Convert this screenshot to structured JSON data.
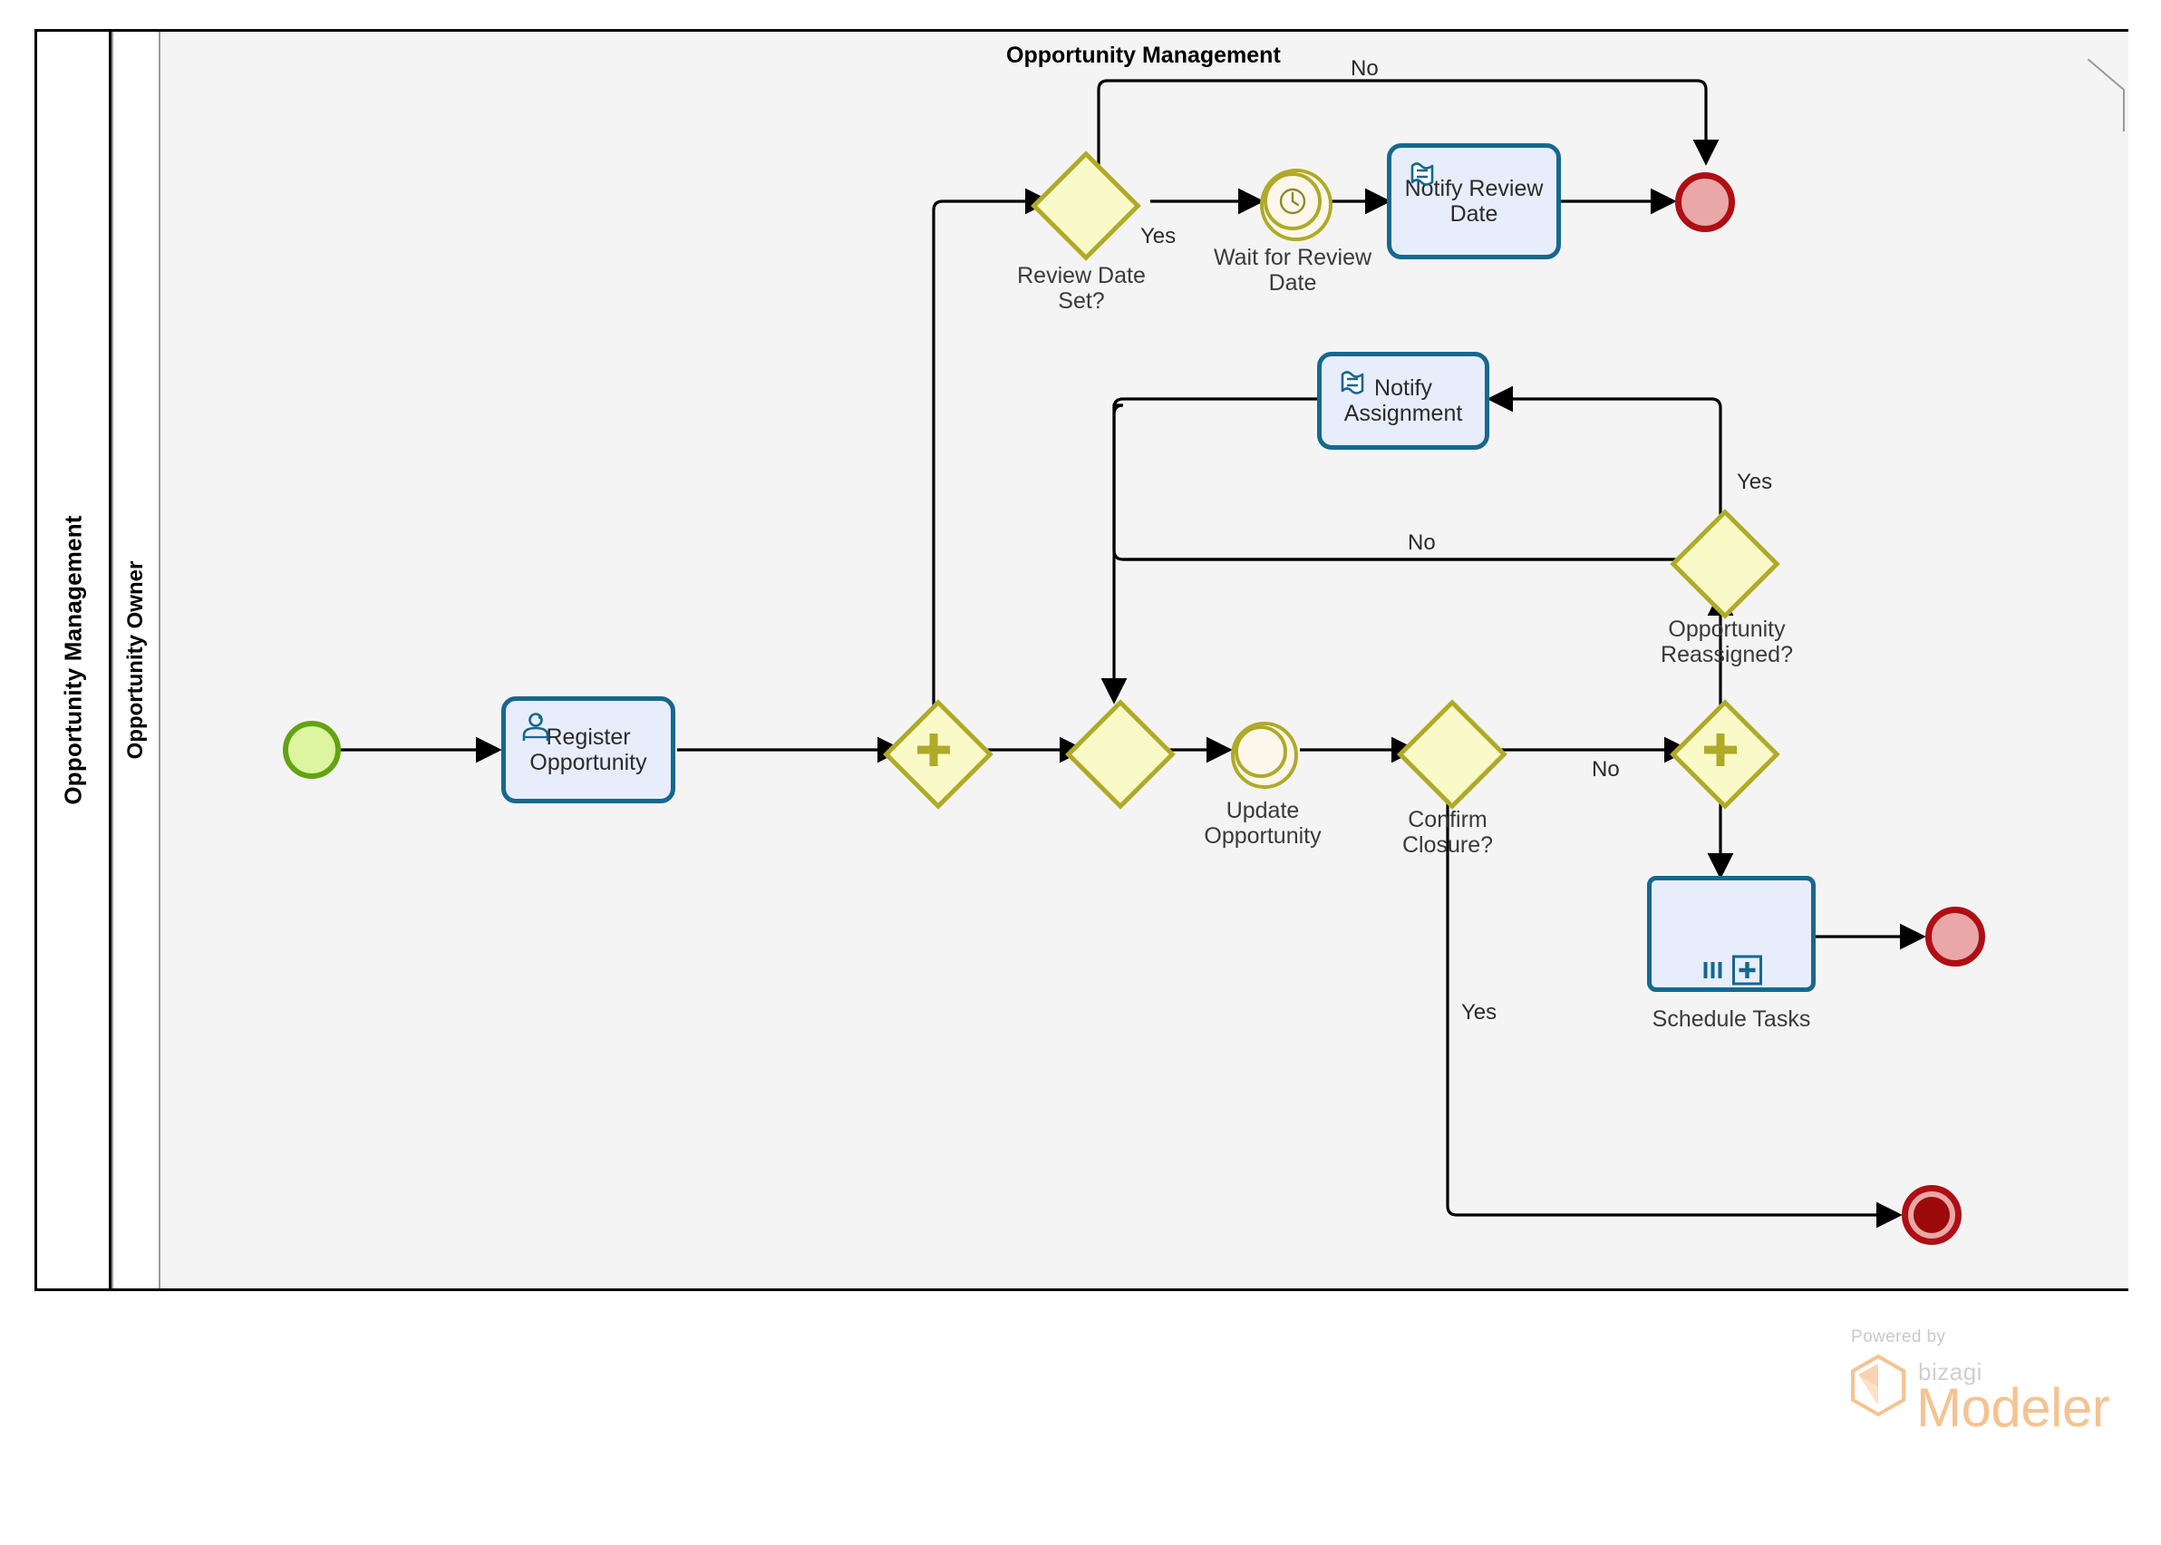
{
  "diagram": {
    "title": "Opportunity Management",
    "pool": {
      "name": "Opportunity Management"
    },
    "lanes": [
      {
        "name": "Opportunity Owner"
      }
    ]
  },
  "watermark": {
    "powered_by": "Powered by",
    "brand": "bizagi",
    "product": "Modeler"
  },
  "colors": {
    "task_fill": "#E8EDFB",
    "task_border": "#15688F",
    "gateway_fill": "#FAFAC8",
    "gateway_border": "#AFAA27",
    "start_fill": "#DDF5A0",
    "start_border": "#63A312",
    "end_fill": "#E9A7A7",
    "end_border": "#AE0E14",
    "terminate_inner": "#9C0A0A",
    "lane_body": "#f4f4f4",
    "watermark_orange": "#F5C391"
  },
  "nodes": [
    {
      "id": "start",
      "label": "",
      "type": "start-event",
      "icon": "none"
    },
    {
      "id": "register",
      "label": "Register\nOpportunity",
      "type": "user-task",
      "icon": "user-icon"
    },
    {
      "id": "split_parallel",
      "label": "",
      "type": "parallel-gateway",
      "icon": "plus-icon"
    },
    {
      "id": "review_date_set",
      "label": "Review Date\nSet?",
      "type": "exclusive-gateway",
      "icon": "none"
    },
    {
      "id": "wait_review_date",
      "label": "Wait for Review\nDate",
      "type": "timer-intermediate-event",
      "icon": "clock-icon"
    },
    {
      "id": "notify_review_date",
      "label": "Notify Review\nDate",
      "type": "script-task",
      "icon": "script-icon"
    },
    {
      "id": "end_review",
      "label": "",
      "type": "end-event",
      "icon": "none"
    },
    {
      "id": "merge_join",
      "label": "",
      "type": "exclusive-gateway",
      "icon": "none"
    },
    {
      "id": "update_opportunity",
      "label": "Update\nOpportunity",
      "type": "intermediate-event",
      "icon": "none"
    },
    {
      "id": "confirm_closure",
      "label": "Confirm\nClosure?",
      "type": "exclusive-gateway",
      "icon": "none"
    },
    {
      "id": "join_parallel",
      "label": "",
      "type": "parallel-gateway",
      "icon": "plus-icon"
    },
    {
      "id": "opportunity_reassigned",
      "label": "Opportunity\nReassigned?",
      "type": "exclusive-gateway",
      "icon": "none"
    },
    {
      "id": "notify_assignment",
      "label": "Notify\nAssignment",
      "type": "script-task",
      "icon": "script-icon"
    },
    {
      "id": "schedule_tasks",
      "label": "Schedule Tasks",
      "type": "multi-instance-subprocess",
      "icon": "parallel-multi-instance-icon"
    },
    {
      "id": "end_schedule",
      "label": "",
      "type": "end-event",
      "icon": "none"
    },
    {
      "id": "terminate_end",
      "label": "",
      "type": "terminate-end-event",
      "icon": "none"
    }
  ],
  "flow_labels": {
    "review_no": "No",
    "review_yes": "Yes",
    "reassigned_yes": "Yes",
    "reassigned_no": "No",
    "closure_no": "No",
    "closure_yes": "Yes"
  }
}
